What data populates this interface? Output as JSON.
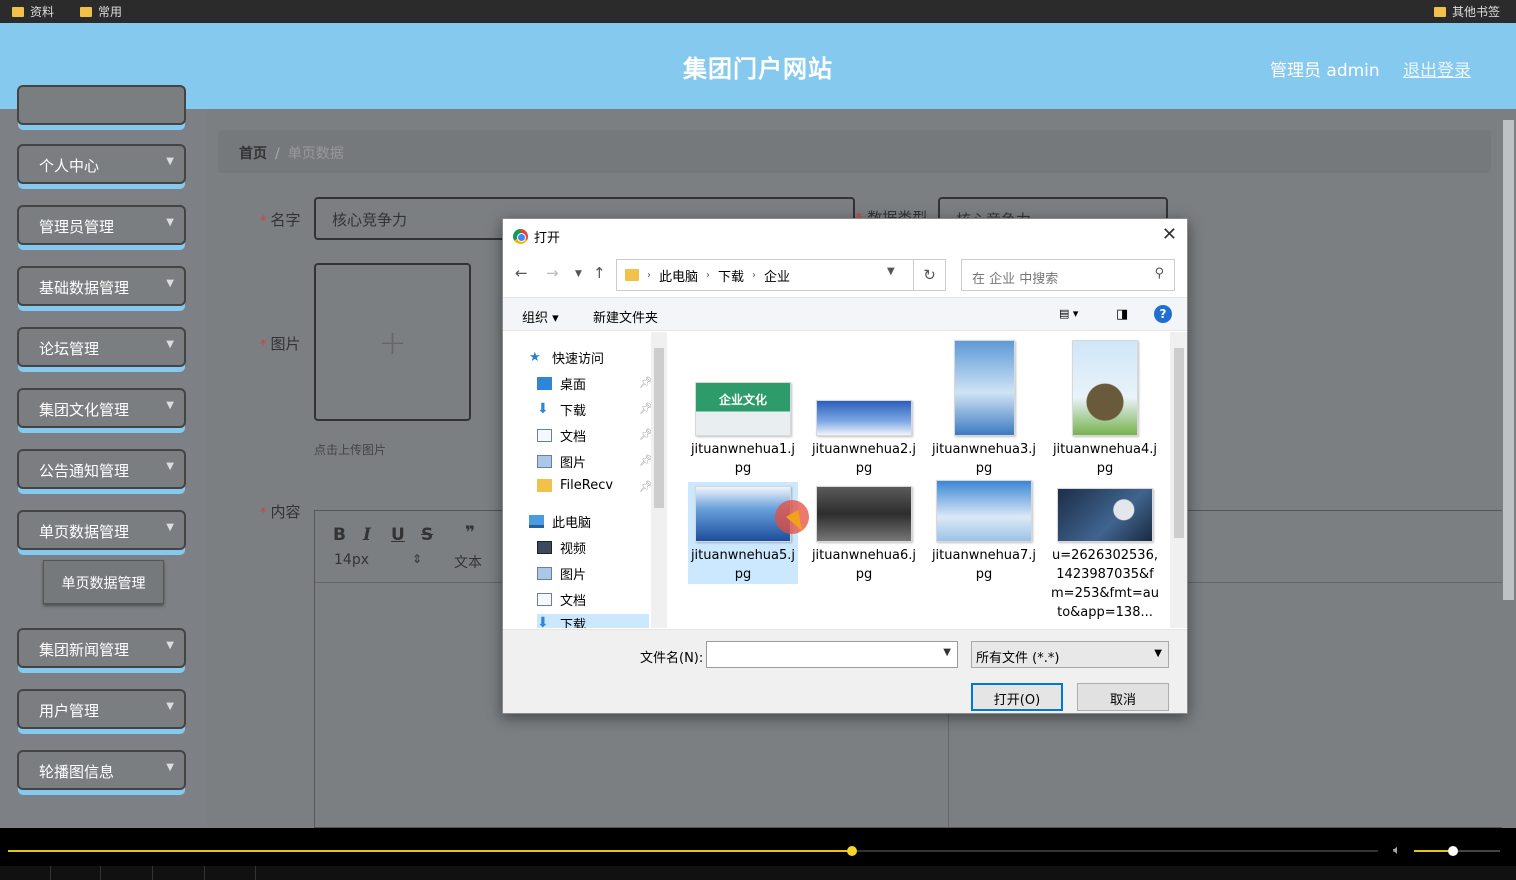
{
  "bookmarks": {
    "left": [
      {
        "label": "资料"
      },
      {
        "label": "常用"
      }
    ],
    "right": {
      "label": "其他书签"
    }
  },
  "header": {
    "title": "集团门户网站",
    "admin": "管理员 admin",
    "logout": "退出登录"
  },
  "sidebar": {
    "items": [
      {
        "label": "个人中心"
      },
      {
        "label": "管理员管理"
      },
      {
        "label": "基础数据管理"
      },
      {
        "label": "论坛管理"
      },
      {
        "label": "集团文化管理"
      },
      {
        "label": "公告通知管理"
      },
      {
        "label": "单页数据管理"
      },
      {
        "label": "集团新闻管理"
      },
      {
        "label": "用户管理"
      },
      {
        "label": "轮播图信息"
      }
    ],
    "sub_item": "单页数据管理"
  },
  "breadcrumb": {
    "home": "首页",
    "sep": "/",
    "current": "单页数据"
  },
  "form": {
    "name_label": "名字",
    "name_value": "核心竞争力",
    "type_label": "数据类型",
    "type_value": "核心竞争力",
    "image_label": "图片",
    "upload_plus": "+",
    "upload_hint": "点击上传图片",
    "content_label": "内容",
    "editor": {
      "bold": "B",
      "italic": "I",
      "underline": "U",
      "strike": "S",
      "quote": "❞",
      "font_size": "14px",
      "text_style": "文本"
    }
  },
  "dialog": {
    "title": "打开",
    "close": "✕",
    "path": [
      "此电脑",
      "下载",
      "企业"
    ],
    "search_placeholder": "在 企业 中搜索",
    "organize": "组织 ▾",
    "new_folder": "新建文件夹",
    "help": "?",
    "tree": [
      {
        "label": "快速访问",
        "icon": "star-icon",
        "pinned": false
      },
      {
        "label": "桌面",
        "icon": "desktop-icon",
        "pinned": true
      },
      {
        "label": "下载",
        "icon": "download-icon",
        "pinned": true
      },
      {
        "label": "文档",
        "icon": "document-icon",
        "pinned": true
      },
      {
        "label": "图片",
        "icon": "picture-icon",
        "pinned": true
      },
      {
        "label": "FileRecv",
        "icon": "folder-icon",
        "pinned": true
      },
      {
        "label": "此电脑",
        "icon": "computer-icon",
        "pinned": false
      },
      {
        "label": "视频",
        "icon": "video-icon",
        "pinned": false
      },
      {
        "label": "图片",
        "icon": "picture-icon",
        "pinned": false
      },
      {
        "label": "文档",
        "icon": "document-icon",
        "pinned": false
      },
      {
        "label": "下载",
        "icon": "download-icon",
        "pinned": false
      }
    ],
    "files": [
      {
        "name": "jituanwnehua1.jpg",
        "thumb_text": "企业文化"
      },
      {
        "name": "jituanwnehua2.jpg"
      },
      {
        "name": "jituanwnehua3.jpg"
      },
      {
        "name": "jituanwnehua4.jpg"
      },
      {
        "name": "jituanwnehua5.jpg",
        "selected": true
      },
      {
        "name": "jituanwnehua6.jpg"
      },
      {
        "name": "jituanwnehua7.jpg"
      },
      {
        "name": "u=2626302536,1423987035&fm=253&fmt=auto&app=138..."
      }
    ],
    "filename_label": "文件名(N):",
    "filename_value": "",
    "filetype": "所有文件 (*.*)",
    "open": "打开(O)",
    "cancel": "取消"
  },
  "player": {
    "progress": 0.616,
    "volume": 0.45
  },
  "colors": {
    "header": "#86c9ee",
    "accent_blue": "#0078d7",
    "player_progress": "#e6c21a"
  }
}
